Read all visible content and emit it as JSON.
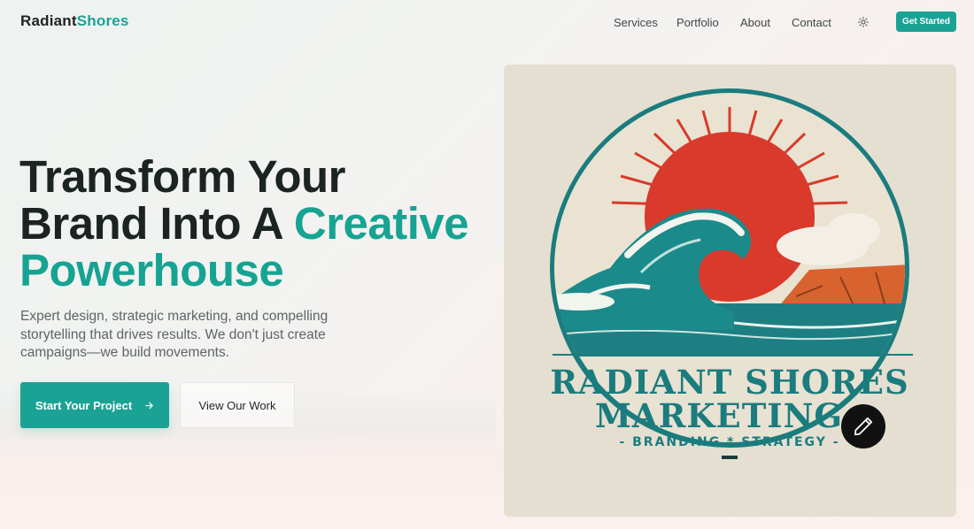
{
  "brand": {
    "name_part1": "Radiant",
    "name_part2": "Shores"
  },
  "nav": {
    "links": [
      "Services",
      "Portfolio",
      "About",
      "Contact"
    ],
    "theme_icon": "sun-icon",
    "cta_label": "Get Started"
  },
  "hero": {
    "title_line1": "Transform Your",
    "title_line2_plain": "Brand Into A ",
    "title_line2_accent": "Creative",
    "title_line3_accent": "Powerhouse",
    "description": "Expert design, strategic marketing, and compelling storytelling that drives results. We don't just create campaigns—we build movements.",
    "primary_button": "Start Your Project",
    "primary_button_icon": "arrow-right-icon",
    "secondary_button": "View Our Work"
  },
  "logo_image": {
    "line1": "RADIANT SHORES",
    "line2": "MARKETING",
    "tagline": "- BRANDING * STRATEGY -"
  },
  "edit_button": {
    "icon": "pencil-icon"
  },
  "colors": {
    "accent": "#1aa394",
    "text_dark": "#1c2323",
    "card_bg": "#e5dfd1",
    "logo_teal": "#1b7c7e",
    "sun_red": "#d93a2b",
    "cliff_orange": "#d8632e"
  }
}
